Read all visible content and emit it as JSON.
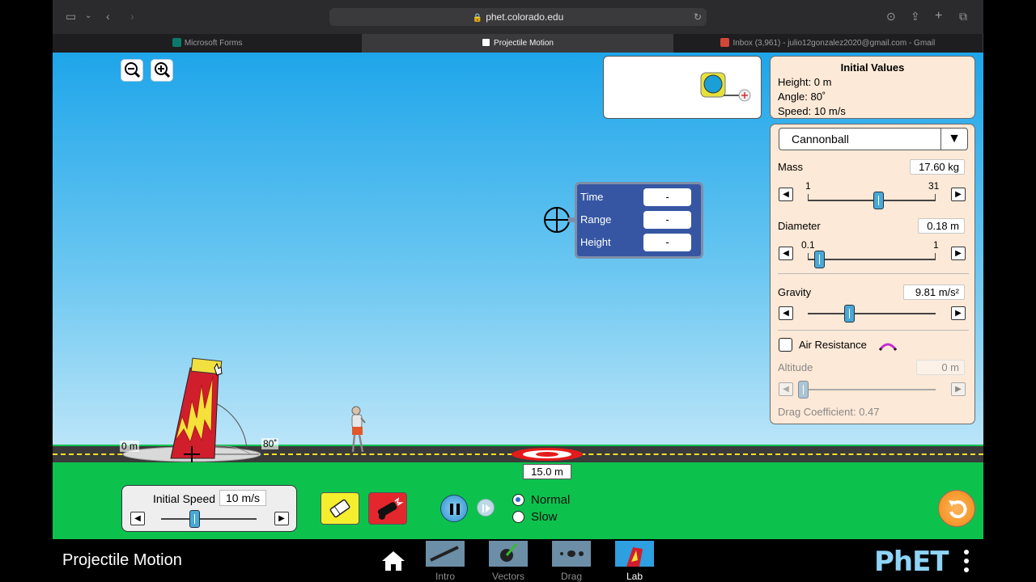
{
  "browser": {
    "url": "phet.colorado.edu",
    "tabs": [
      {
        "label": "Microsoft Forms",
        "active": false
      },
      {
        "label": "Projectile Motion",
        "active": true
      },
      {
        "label": "Inbox (3,961) - julio12gonzalez2020@gmail.com - Gmail",
        "active": false
      }
    ]
  },
  "initial_values": {
    "title": "Initial Values",
    "height": "Height: 0 m",
    "angle": "Angle: 80˚",
    "speed": "Speed: 10 m/s"
  },
  "projectile": {
    "selected": "Cannonball",
    "mass": {
      "label": "Mass",
      "value": "17.60 kg",
      "min_label": "1",
      "max_label": "31",
      "level": 0.55
    },
    "diameter": {
      "label": "Diameter",
      "value": "0.18 m",
      "min_label": "0.1",
      "max_label": "1",
      "level": 0.09
    },
    "gravity": {
      "label": "Gravity",
      "value": "9.81 m/s²",
      "level": 0.32
    },
    "air_resistance": {
      "label": "Air Resistance",
      "checked": false
    },
    "altitude": {
      "label": "Altitude",
      "value": "0 m",
      "level": 0.0
    },
    "drag_coefficient": "Drag Coefficient: 0.47"
  },
  "measure_tool": {
    "time_label": "Time",
    "time_value": "-",
    "range_label": "Range",
    "range_value": "-",
    "height_label": "Height",
    "height_value": "-"
  },
  "scene": {
    "origin_label": "0 m",
    "angle_label": "80˚",
    "target_distance": "15.0 m"
  },
  "controls": {
    "initial_speed_label": "Initial Speed",
    "initial_speed_value": "10 m/s",
    "initial_speed_level": 0.35,
    "speed_normal": "Normal",
    "speed_slow": "Slow",
    "selected_speed": "Normal"
  },
  "navbar": {
    "title": "Projectile Motion",
    "screens": [
      {
        "label": "Intro",
        "active": false
      },
      {
        "label": "Vectors",
        "active": false
      },
      {
        "label": "Drag",
        "active": false
      },
      {
        "label": "Lab",
        "active": true
      }
    ],
    "brand": "PhET"
  },
  "colors": {
    "panel_bg": "#fde9d7",
    "tool_bg": "#3656a3",
    "grass": "#0cc24d",
    "slider_thumb": "#4aa8d5"
  }
}
